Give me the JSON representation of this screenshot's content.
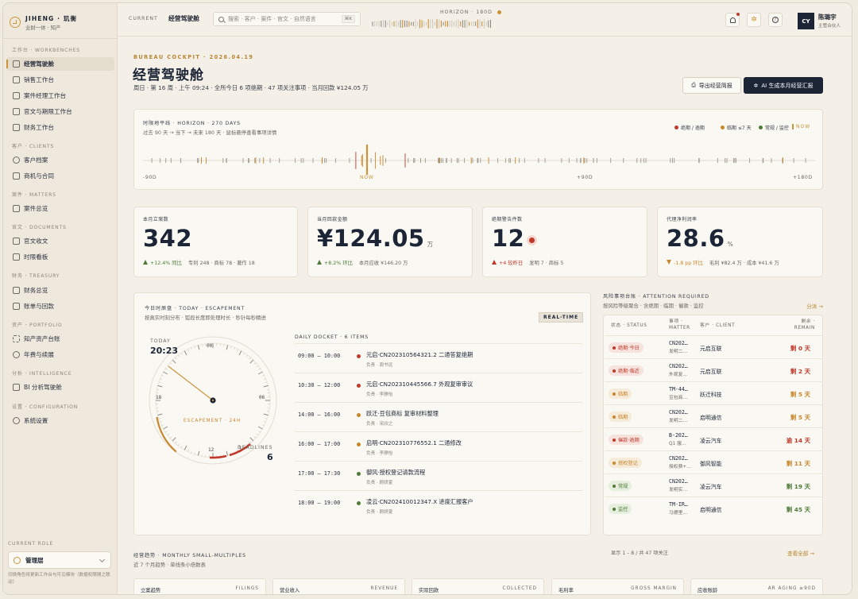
{
  "brand": {
    "name": "JIHENG · 玑衡",
    "tagline": "业财一体 · 知产"
  },
  "sidebar": {
    "sections": [
      {
        "label": "工作台 · WORKBENCHES",
        "items": [
          {
            "label": "经营驾驶舱",
            "icon": "dashboard-icon",
            "active": true
          },
          {
            "label": "销售工作台",
            "icon": "briefcase-icon"
          },
          {
            "label": "案件经理工作台",
            "icon": "folder-icon"
          },
          {
            "label": "官文与期限工作台",
            "icon": "calendar-icon"
          },
          {
            "label": "财务工作台",
            "icon": "wallet-icon"
          }
        ]
      },
      {
        "label": "客户 · CLIENTS",
        "items": [
          {
            "label": "客户档案",
            "icon": "users-icon"
          },
          {
            "label": "商机与合同",
            "icon": "contract-icon"
          }
        ]
      },
      {
        "label": "案件 · MATTERS",
        "items": [
          {
            "label": "案件总览",
            "icon": "document-icon"
          }
        ]
      },
      {
        "label": "官文 · DOCUMENTS",
        "items": [
          {
            "label": "官文收文",
            "icon": "inbox-icon"
          },
          {
            "label": "时限看板",
            "icon": "clock-board-icon"
          }
        ]
      },
      {
        "label": "财务 · TREASURY",
        "items": [
          {
            "label": "财务总览",
            "icon": "treasury-icon"
          },
          {
            "label": "账单与回款",
            "icon": "bill-icon"
          }
        ]
      },
      {
        "label": "资产 · PORTFOLIO",
        "items": [
          {
            "label": "知产资产台账",
            "icon": "layers-icon"
          },
          {
            "label": "年费与续展",
            "icon": "renew-icon"
          }
        ]
      },
      {
        "label": "分析 · INTELLIGENCE",
        "items": [
          {
            "label": "BI 分析驾驶舱",
            "icon": "bar-chart-icon"
          }
        ]
      },
      {
        "label": "设置 · CONFIGURATION",
        "items": [
          {
            "label": "系统设置",
            "icon": "gear-icon"
          }
        ]
      }
    ],
    "role_label": "CURRENT ROLE",
    "role_value": "管理层",
    "role_note": "切换角色将更新工作台与可见模块（数据权限随之联动）"
  },
  "topbar": {
    "crumb_key": "CURRENT",
    "crumb_value": "经营驾驶舱",
    "search_placeholder": "搜索 · 客户 · 案件 · 官文 · 自然语言",
    "search_kbd": "⌘K",
    "horizon_label": "HORIZON · 180D",
    "user_initials": "CY",
    "user_name": "陈璐宇",
    "user_role": "主管合伙人"
  },
  "page": {
    "kicker": "BUREAU COCKPIT · 2026.04.19",
    "title": "经营驾驶舱",
    "subtitle": "周日 · 第 16 周 · 上午 09:24 · 全所今日 6 项绝期 · 47 项关注事项 · 当月回款 ¥124.05 万",
    "export_label": "导出经营简报",
    "ai_label": "AI 生成本月经营汇报"
  },
  "horizon": {
    "title": "时限地平线 · HORIZON · 270 DAYS",
    "subtitle": "过去 90 天 → 当下 → 未来 180 天 · 鼠标悬停查看事项详情",
    "legend": [
      {
        "label": "绝期 / 逾期",
        "color": "#c0392b"
      },
      {
        "label": "临期 ≤7 天",
        "color": "#c7862c"
      },
      {
        "label": "常规 / 监控",
        "color": "#4f7a3a"
      },
      {
        "label": "NOW",
        "color": "#c9953b"
      }
    ],
    "axis_labels": [
      "-90D",
      "NOW",
      "+90D",
      "+180D"
    ]
  },
  "kpis": [
    {
      "label": "本月立案数",
      "value": "342",
      "unit": "",
      "delta": "+12.4% 同比",
      "delta_dir": "up",
      "detail": "专利 248 · 商标 78 · 著作 18"
    },
    {
      "label": "当月回款金额",
      "value": "¥124.05",
      "unit": "万",
      "delta": "+8.2% 环比",
      "delta_dir": "up",
      "detail": "本月应收 ¥146.20 万"
    },
    {
      "label": "绝期警告件数",
      "value": "12",
      "unit": "",
      "delta": "+4 较昨日",
      "delta_dir": "up-bad",
      "detail": "发明 7 · 商标 5"
    },
    {
      "label": "代理净利润率",
      "value": "28.6",
      "unit": "%",
      "delta": "-1.8 pp 环比",
      "delta_dir": "down",
      "detail": "毛利 ¥82.4 万 · 成本 ¥41.6 万"
    }
  ],
  "today": {
    "title": "今日时辰盘 · TODAY · ESCAPEMENT",
    "subtitle": "按真实时刻分布 · 弧段长度即处理时长 · 秒针每秒精进",
    "realtime": "REAL-TIME",
    "clock_label": "TODAY",
    "clock_time": "20:23",
    "clock_ticks": [
      "00",
      "06",
      "12",
      "18"
    ],
    "clock_caption": "ESCAPEMENT · 24H",
    "deadlines_label": "DEADLINES",
    "deadlines_count": "6",
    "docket_label": "DAILY DOCKET · 6 ITEMS",
    "docket": [
      {
        "time": "09:00 — 10:00",
        "title": "元启·CN202310564321.2 二通答复绝期",
        "owner": "负责 · 周书远",
        "color": "#c0392b"
      },
      {
        "time": "10:30 — 12:00",
        "title": "元启·CN202310445566.7 外观复审审议",
        "owner": "负责 · 李静怡",
        "color": "#c0392b"
      },
      {
        "time": "14:00 — 16:00",
        "title": "跃迁·豆包商标 复审材料整理",
        "owner": "负责 · 宋欣之",
        "color": "#c7862c"
      },
      {
        "time": "16:00 — 17:00",
        "title": "启明·CN202310776552.1 二通修改",
        "owner": "负责 · 李静怡",
        "color": "#c7862c"
      },
      {
        "time": "17:00 — 17:30",
        "title": "御风·授权登记请款流程",
        "owner": "负责 · 顾妍夏",
        "color": "#4f7a3a"
      },
      {
        "time": "18:00 — 19:00",
        "title": "凌云·CN202410012347.X 进度汇报客户",
        "owner": "负责 · 顾妍夏",
        "color": "#4f7a3a"
      }
    ]
  },
  "attention": {
    "title": "风险事项台账 · ATTENTION REQUIRED",
    "subtitle": "按风险等级聚合 · 含绝期 · 临期 · 催款 · 监控",
    "link": "分派 →",
    "headers": {
      "status": "状态 · STATUS",
      "matter": "事项 · MATTER",
      "client": "客户 · CLIENT",
      "remain": "剩余 · REMAIN"
    },
    "rows": [
      {
        "status": "绝期·今日",
        "tone": "red",
        "matter": "CN202…",
        "matter2": "发明二…",
        "client": "元启互联",
        "remain": "剩 0 天"
      },
      {
        "status": "绝期·临近",
        "tone": "red",
        "matter": "CN202…",
        "matter2": "外观复…",
        "client": "元启互联",
        "remain": "剩 2 天"
      },
      {
        "status": "临期",
        "tone": "orange",
        "matter": "TM-44…",
        "matter2": "豆包商…",
        "client": "跃迁科技",
        "remain": "剩 5 天"
      },
      {
        "status": "临期",
        "tone": "orange",
        "matter": "CN202…",
        "matter2": "发明二…",
        "client": "启明通信",
        "remain": "剩 5 天"
      },
      {
        "status": "催款·逾期",
        "tone": "red",
        "matter": "B-202…",
        "matter2": "Q1 服…",
        "client": "凌云汽车",
        "remain": "逾 14 天"
      },
      {
        "status": "授权登记",
        "tone": "orange",
        "matter": "CN202…",
        "matter2": "授权费+…",
        "client": "御风智能",
        "remain": "剩 11 天"
      },
      {
        "status": "常规",
        "tone": "green",
        "matter": "CN202…",
        "matter2": "发明实…",
        "client": "凌云汽车",
        "remain": "剩 19 天"
      },
      {
        "status": "监控",
        "tone": "green",
        "matter": "TM-IR…",
        "matter2": "马德里…",
        "client": "启明通信",
        "remain": "剩 45 天"
      }
    ],
    "footer": "显示 1 – 8 / 共 47 项关注",
    "more": "查看全部 →"
  },
  "trend": {
    "title": "经营趋势 · MONTHLY SMALL-MULTIPLES",
    "subtitle": "近 7 个月趋势 · 单线条小倍数表",
    "cards": [
      {
        "cn": "立案趋势",
        "en": "FILINGS"
      },
      {
        "cn": "营业收入",
        "en": "REVENUE"
      },
      {
        "cn": "实际回款",
        "en": "COLLECTED"
      },
      {
        "cn": "毛利率",
        "en": "GROSS MARGIN"
      },
      {
        "cn": "应收账龄",
        "en": "AR AGING ≥90D"
      }
    ]
  },
  "colors": {
    "gold": "#c9953b",
    "navy": "#1b2536",
    "red": "#c0392b",
    "orange": "#c7862c",
    "green": "#4f7a3a"
  }
}
